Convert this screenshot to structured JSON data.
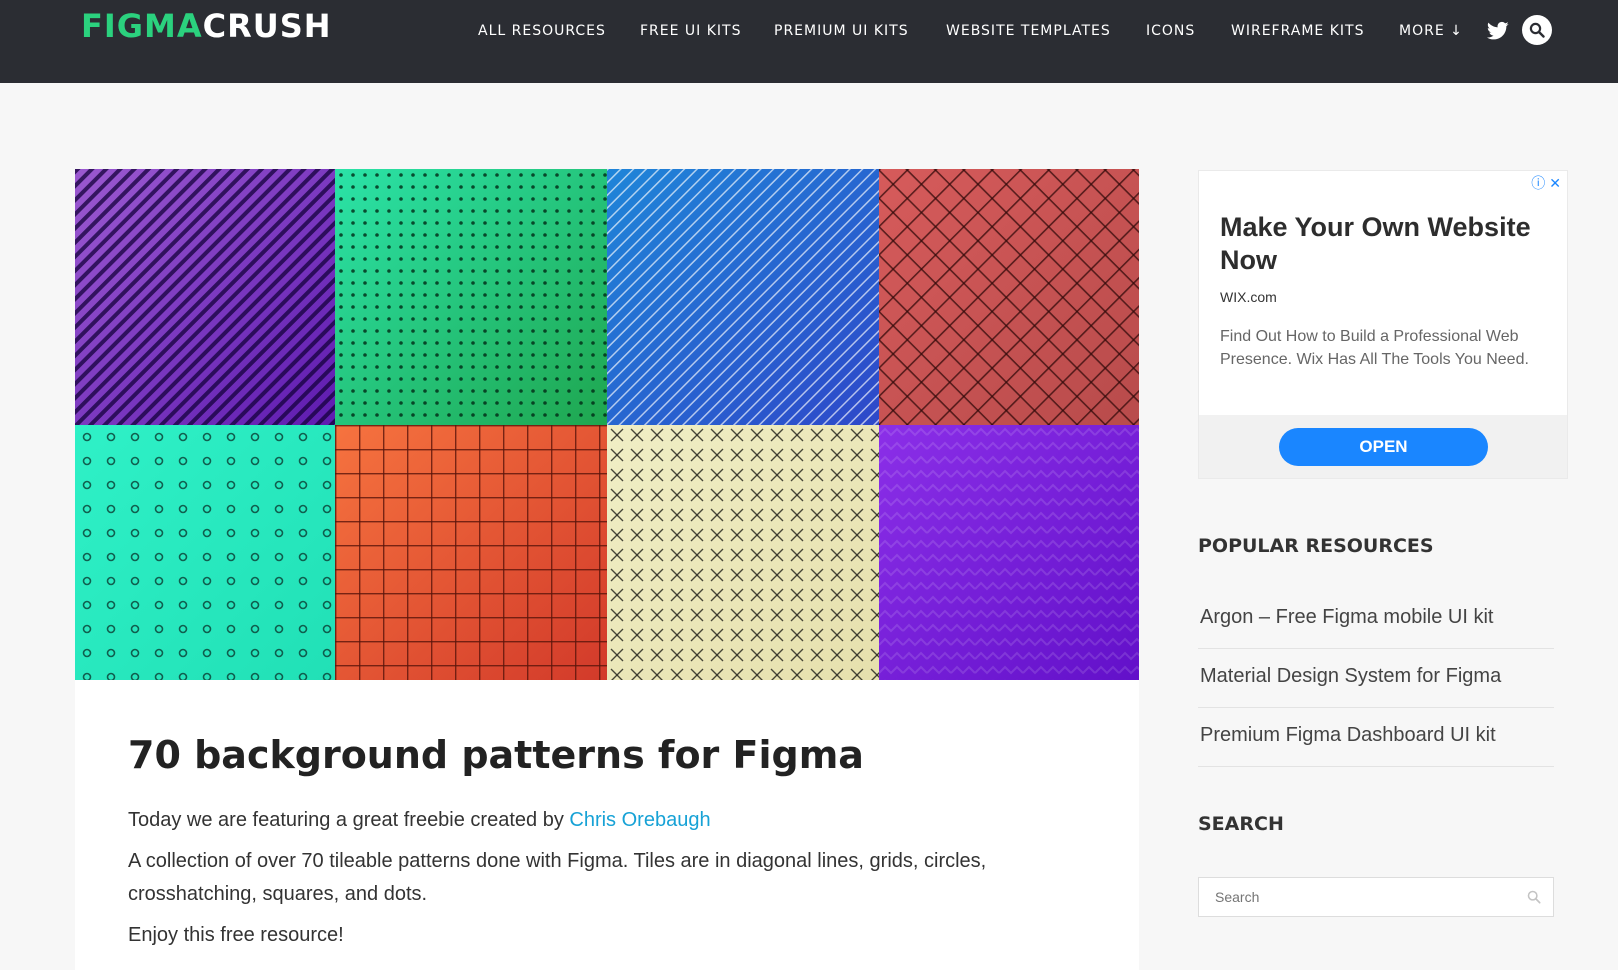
{
  "brand": {
    "logo_part1": "FIGMA",
    "logo_part2": "CRUSH",
    "accent": "#2bd17e",
    "header_bg": "#2b2d33"
  },
  "nav": {
    "items": [
      {
        "label": "ALL RESOURCES"
      },
      {
        "label": "FREE UI KITS"
      },
      {
        "label": "PREMIUM UI KITS"
      },
      {
        "label": "WEBSITE TEMPLATES"
      },
      {
        "label": "ICONS"
      },
      {
        "label": "WIREFRAME KITS"
      },
      {
        "label": "MORE ↓"
      }
    ],
    "twitter_icon": "twitter-icon",
    "search_icon": "search-icon"
  },
  "hero": {
    "tiles": [
      {
        "pattern": "diagonal-lines",
        "colors": [
          "#9b59d0",
          "#5e1bb0"
        ]
      },
      {
        "pattern": "dots",
        "colors": [
          "#2be3a8",
          "#1fa64f"
        ]
      },
      {
        "pattern": "diagonal-lines-light",
        "colors": [
          "#1f85d8",
          "#2e48c9"
        ]
      },
      {
        "pattern": "crosshatch",
        "colors": [
          "#d65b5b",
          "#b84b4b"
        ]
      },
      {
        "pattern": "circles",
        "colors": [
          "#2ff1c7",
          "#21e0b6"
        ]
      },
      {
        "pattern": "grid",
        "colors": [
          "#f6733f",
          "#d23a2a"
        ]
      },
      {
        "pattern": "x-marks",
        "colors": [
          "#f0eec5",
          "#e6e0ad"
        ]
      },
      {
        "pattern": "zigzag",
        "colors": [
          "#8b2fe8",
          "#6210c9"
        ]
      }
    ]
  },
  "article": {
    "title": "70 background patterns for Figma",
    "intro_prefix": "Today we are featuring a great freebie created by ",
    "author_link": "Chris Orebaugh",
    "body_line1": "A collection of over 70 tileable patterns done with Figma. Tiles are in diagonal lines, grids, circles,",
    "body_line2": "crosshatching, squares, and dots.",
    "closing": "Enjoy this free resource!",
    "link_color": "#17a2d6"
  },
  "ad": {
    "headline": "Make Your Own Website Now",
    "domain": "WIX.com",
    "description": "Find Out How to Build a Professional Web Presence. Wix Has All The Tools You Need.",
    "cta": "OPEN",
    "info_icon": "ⓘ",
    "close_icon": "✕",
    "cta_color": "#1a86ff"
  },
  "sidebar": {
    "popular_heading": "POPULAR RESOURCES",
    "popular_items": [
      {
        "label": "Argon – Free Figma mobile UI kit"
      },
      {
        "label": "Material Design System for Figma"
      },
      {
        "label": "Premium Figma Dashboard UI kit"
      }
    ],
    "search_heading": "SEARCH",
    "search_placeholder": "Search"
  }
}
